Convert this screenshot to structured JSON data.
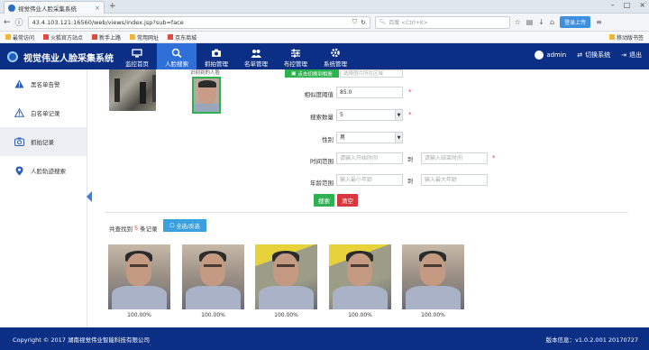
{
  "browser": {
    "tab_title": "视觉伟业人脸采集系统",
    "url": "43.4.103.121:16560/web/views/index.jsp?sub=face",
    "search_placeholder": "百度 <Ctrl+K>",
    "login_label": "登录上传",
    "bookmarks": [
      "最常访问",
      "火狐官方站点",
      "新手上路",
      "常用网址",
      "京东商城"
    ],
    "mobile_bookmarks": "移动版书签"
  },
  "header": {
    "title": "视觉伟业人脸采集系统",
    "nav": [
      {
        "label": "监控首页",
        "icon": "monitor-icon"
      },
      {
        "label": "人脸搜索",
        "icon": "search-icon",
        "active": true
      },
      {
        "label": "抓拍管理",
        "icon": "camera-icon"
      },
      {
        "label": "名单管理",
        "icon": "users-icon"
      },
      {
        "label": "布控管理",
        "icon": "sliders-icon"
      },
      {
        "label": "系统管理",
        "icon": "gear-icon"
      }
    ],
    "user": "admin",
    "switch_label": "切换系统",
    "logout_label": "退出"
  },
  "sidebar": {
    "items": [
      {
        "label": "黑名单告警",
        "icon": "warning-icon"
      },
      {
        "label": "白名单记录",
        "icon": "warning-outline-icon"
      },
      {
        "label": "抓拍记录",
        "icon": "camera-record-icon",
        "active": true
      },
      {
        "label": "人脸轨迹搜索",
        "icon": "location-icon"
      }
    ]
  },
  "search_form": {
    "clipped_label": "识别到的人脸",
    "upload_button": "点击切换到相册",
    "upload_hint": "选择图片所在区域",
    "similarity_label": "相似度阈值",
    "similarity_value": "85.0",
    "count_label": "搜索数量",
    "count_value": "5",
    "gender_label": "性别",
    "gender_value": "男",
    "time_label": "时间范围",
    "time_start_placeholder": "请输入开始时间",
    "time_to": "到",
    "time_end_placeholder": "请输入结束时间",
    "age_label": "年龄范围",
    "age_min_placeholder": "输入最小年龄",
    "age_to": "到",
    "age_max_placeholder": "输入最大年龄",
    "search_button": "搜索",
    "clear_button": "清空",
    "required_mark": "*"
  },
  "results": {
    "found_prefix": "共查找到",
    "found_count": "5",
    "found_suffix": "条记录",
    "select_all": "全选/反选",
    "items": [
      {
        "score": "100.00%"
      },
      {
        "score": "100.00%"
      },
      {
        "score": "100.00%"
      },
      {
        "score": "100.00%"
      },
      {
        "score": "100.00%"
      }
    ]
  },
  "footer": {
    "copyright": "Copyright © 2017 湖南视觉伟业智能科技有限公司",
    "version": "版本信息：v1.0.2.001 20170727"
  },
  "colors": {
    "header_bg": "#0b2f85",
    "active_nav": "#2f6fd8",
    "green": "#2eb24f",
    "red": "#d9363e",
    "blue": "#3aa0e0"
  }
}
